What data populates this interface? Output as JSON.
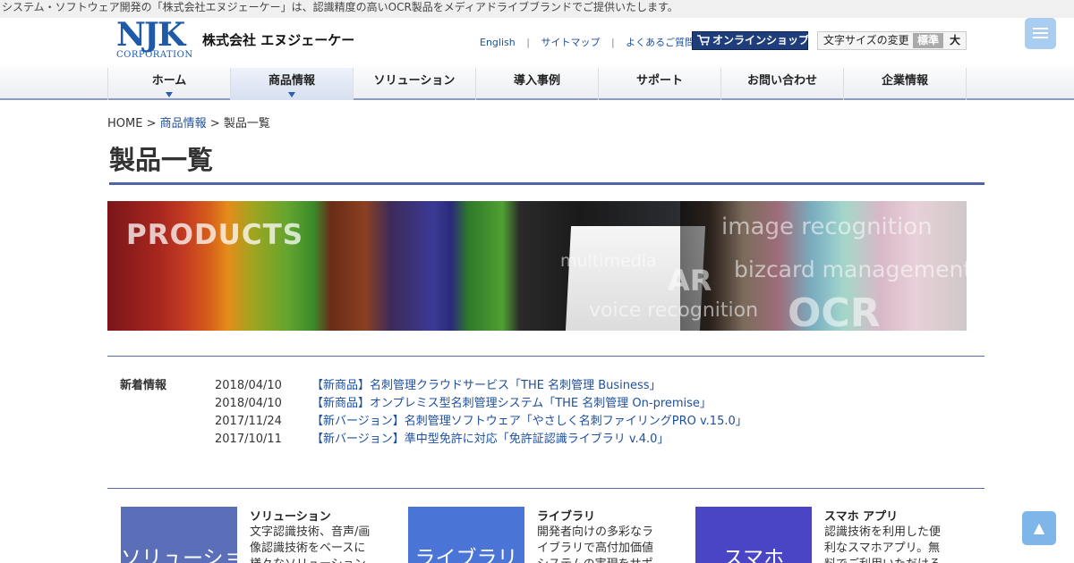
{
  "topbar": {
    "text": "システム・ソフトウェア開発の「株式会社エヌジェーケー」は、認識精度の高いOCR製品をメディアドライブブランドでご提供いたします。"
  },
  "header": {
    "logo_main": "NJK",
    "logo_sub": "CORPORATION",
    "company": "株式会社 エヌジェーケー",
    "links": [
      "English",
      "サイトマップ",
      "よくあるご質問"
    ],
    "separators": [
      "|",
      "|"
    ],
    "shop_label": "オンラインショップ",
    "fontsize": {
      "label": "文字サイズの変更",
      "standard": "標準",
      "large": "大"
    }
  },
  "nav": {
    "items": [
      "ホーム",
      "商品情報",
      "ソリューション",
      "導入事例",
      "サポート",
      "お問い合わせ",
      "企業情報"
    ],
    "active": "商品情報"
  },
  "breadcrumb": {
    "home": "HOME",
    "sep1": ">",
    "parent": "商品情報",
    "sep2": ">",
    "current": "製品一覧"
  },
  "page_title": "製品一覧",
  "banner": {
    "heading": "PRODUCTS",
    "words": [
      "image recognition",
      "multimedia",
      "bizcard management",
      "AR",
      "voice recognition",
      "OCR"
    ]
  },
  "news": {
    "label": "新着情報",
    "items": [
      {
        "date": "2018/04/10",
        "title": "【新商品】名刺管理クラウドサービス「THE 名刺管理 Business」"
      },
      {
        "date": "2018/04/10",
        "title": "【新商品】オンプレミス型名刺管理システム「THE 名刺管理 On-premise」"
      },
      {
        "date": "2017/11/24",
        "title": "【新バージョン】名刺管理ソフトウェア「やさしく名刺ファイリングPRO v.15.0」"
      },
      {
        "date": "2017/10/11",
        "title": "【新バージョン】準中型免許に対応「免許証認識ライブラリ v.4.0」"
      }
    ]
  },
  "cards": [
    {
      "thumb": "ソリューション",
      "title": "ソリューション",
      "desc": "文字認識技術、音声/画像認識技術をベースに様々なソリューションを",
      "color": "#5a6fb8"
    },
    {
      "thumb": "ライブラリ",
      "title": "ライブラリ",
      "desc": "開発者向けの多彩なライブラリで高付加価値システムの実現をサポ",
      "color": "#4a74d6"
    },
    {
      "thumb": "スマホ",
      "title": "スマホ アプリ",
      "desc": "認識技術を利用した便利なスマホアプリ。無料でご利用いただける",
      "color": "#4a45c4"
    }
  ],
  "to_top": "▲",
  "colors": {
    "link": "#1e4f9c",
    "rule": "#4f64a6",
    "shop": "#1e3d7a",
    "menu": "#a8cdf0",
    "to_top": "#7fb6ea"
  }
}
